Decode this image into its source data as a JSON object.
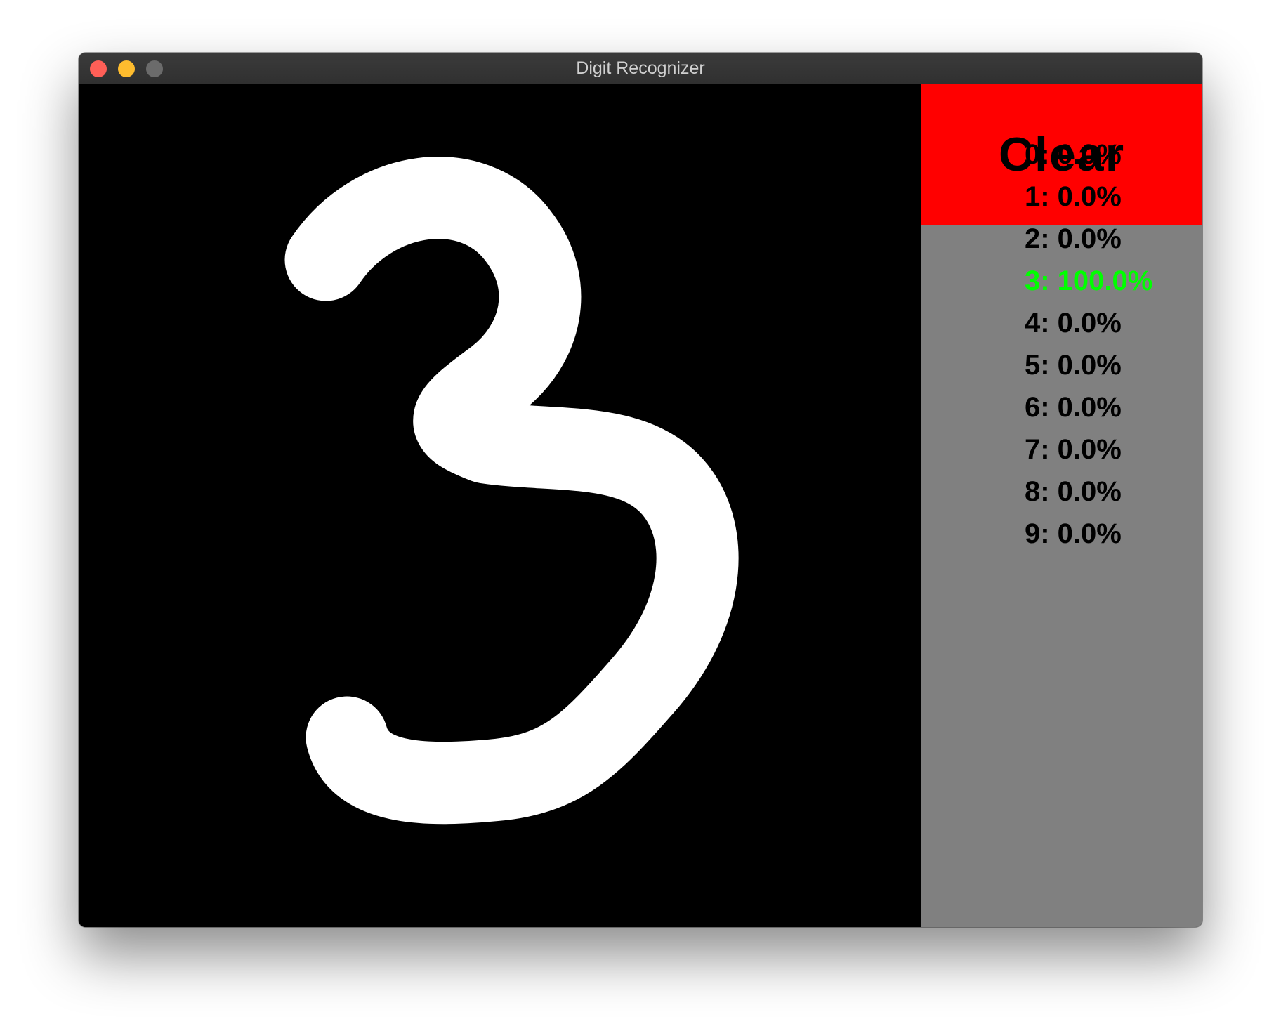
{
  "window": {
    "title": "Digit Recognizer",
    "traffic_lights": [
      {
        "name": "close",
        "color": "#ff5f57"
      },
      {
        "name": "minimize",
        "color": "#febc2e"
      },
      {
        "name": "zoom",
        "color": "#6b6b6b"
      }
    ]
  },
  "canvas": {
    "background": "#000000",
    "stroke_color": "#ffffff",
    "drawn_digit": "3"
  },
  "sidebar": {
    "background": "#808080",
    "clear_button": {
      "label": "Clear",
      "color": "#ff0000"
    },
    "predictions": [
      {
        "text": "0: 0.0%",
        "digit": 0,
        "probability": 0.0,
        "color": "#000000"
      },
      {
        "text": "1: 0.0%",
        "digit": 1,
        "probability": 0.0,
        "color": "#000000"
      },
      {
        "text": "2: 0.0%",
        "digit": 2,
        "probability": 0.0,
        "color": "#000000"
      },
      {
        "text": "3: 100.0%",
        "digit": 3,
        "probability": 100.0,
        "color": "#00ff00"
      },
      {
        "text": "4: 0.0%",
        "digit": 4,
        "probability": 0.0,
        "color": "#000000"
      },
      {
        "text": "5: 0.0%",
        "digit": 5,
        "probability": 0.0,
        "color": "#000000"
      },
      {
        "text": "6: 0.0%",
        "digit": 6,
        "probability": 0.0,
        "color": "#000000"
      },
      {
        "text": "7: 0.0%",
        "digit": 7,
        "probability": 0.0,
        "color": "#000000"
      },
      {
        "text": "8: 0.0%",
        "digit": 8,
        "probability": 0.0,
        "color": "#000000"
      },
      {
        "text": "9: 0.0%",
        "digit": 9,
        "probability": 0.0,
        "color": "#000000"
      }
    ]
  }
}
